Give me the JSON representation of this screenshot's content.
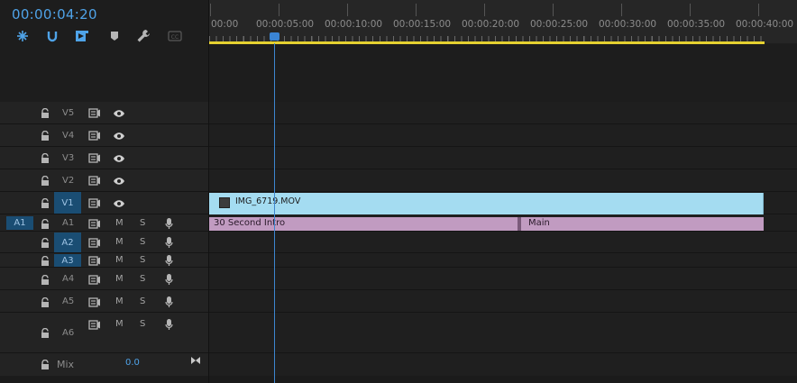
{
  "timecode": "00:00:04:20",
  "toolbar": {
    "icons": [
      "snap-icon",
      "linked-selection-icon",
      "add-marker-icon",
      "marker-icon",
      "wrench-icon",
      "captions-icon"
    ]
  },
  "ruler": {
    "labels": [
      "00:00",
      "00:00:05:00",
      "00:00:10:00",
      "00:00:15:00",
      "00:00:20:00",
      "00:00:25:00",
      "00:00:30:00",
      "00:00:35:00",
      "00:00:40:00"
    ]
  },
  "tracks": {
    "video": [
      {
        "label": "V5"
      },
      {
        "label": "V4"
      },
      {
        "label": "V3"
      },
      {
        "label": "V2"
      },
      {
        "label": "V1",
        "targeted": true
      }
    ],
    "audio": [
      {
        "label": "A1",
        "source": "A1",
        "targeted": false
      },
      {
        "label": "A2",
        "targeted": true
      },
      {
        "label": "A3",
        "targeted": true
      },
      {
        "label": "A4"
      },
      {
        "label": "A5"
      },
      {
        "label": "A6"
      }
    ],
    "mute_label": "M",
    "solo_label": "S"
  },
  "mix": {
    "label": "Mix",
    "value": "0.0"
  },
  "clips": {
    "video": {
      "name": "IMG_6719.MOV"
    },
    "audio": [
      {
        "name": "30 Second Intro"
      },
      {
        "name": "Main"
      }
    ]
  },
  "colors": {
    "accent": "#4fa3e8",
    "playhead": "#3d86d0",
    "work_area": "#e5d130",
    "video_clip": "#a4dcf1",
    "audio_clip": "#c19bc1"
  }
}
